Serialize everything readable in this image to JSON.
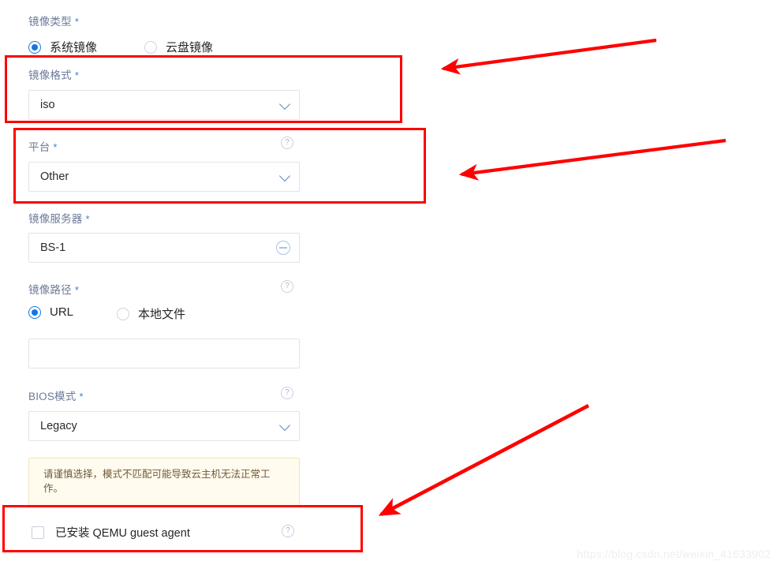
{
  "form": {
    "image_type": {
      "label": "镜像类型",
      "required_mark": "*",
      "options": [
        {
          "label": "系统镜像",
          "selected": true
        },
        {
          "label": "云盘镜像",
          "selected": false
        }
      ]
    },
    "image_format": {
      "label": "镜像格式",
      "required_mark": "*",
      "value": "iso"
    },
    "platform": {
      "label": "平台",
      "required_mark": "*",
      "value": "Other",
      "help_icon": "?"
    },
    "image_server": {
      "label": "镜像服务器",
      "required_mark": "*",
      "value": "BS-1",
      "clear_icon": "minus-circle-icon"
    },
    "image_path": {
      "label": "镜像路径",
      "required_mark": "*",
      "help_icon": "?",
      "options": [
        {
          "label": "URL",
          "selected": true
        },
        {
          "label": "本地文件",
          "selected": false
        }
      ],
      "url_value": "",
      "url_placeholder": ""
    },
    "bios_mode": {
      "label": "BIOS模式",
      "required_mark": "*",
      "value": "Legacy",
      "help_icon": "?",
      "warning": "请谨慎选择，模式不匹配可能导致云主机无法正常工作。"
    },
    "qemu_agent": {
      "label": "已安装 QEMU guest agent",
      "checked": false,
      "help_icon": "?"
    }
  },
  "annotations": {
    "highlight_color": "#fe0000",
    "boxes": [
      {
        "name": "image-format-highlight"
      },
      {
        "name": "platform-highlight"
      },
      {
        "name": "qemu-agent-highlight"
      }
    ],
    "arrows": [
      {
        "name": "arrow-to-image-format"
      },
      {
        "name": "arrow-to-platform"
      },
      {
        "name": "arrow-to-qemu-agent"
      }
    ]
  },
  "watermark": {
    "text": "https://blog.csdn.net/weixin_41633902"
  }
}
